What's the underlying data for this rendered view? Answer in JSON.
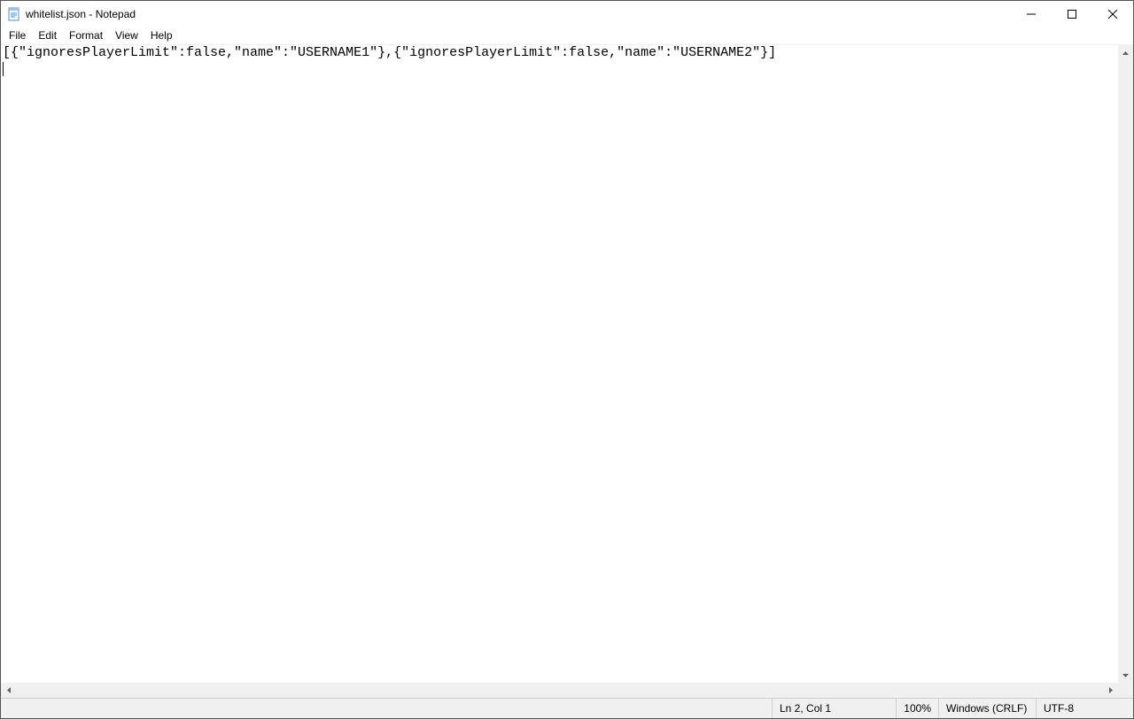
{
  "window": {
    "title": "whitelist.json - Notepad"
  },
  "menu": {
    "items": [
      "File",
      "Edit",
      "Format",
      "View",
      "Help"
    ]
  },
  "document": {
    "content": "[{\"ignoresPlayerLimit\":false,\"name\":\"USERNAME1\"},{\"ignoresPlayerLimit\":false,\"name\":\"USERNAME2\"}]"
  },
  "status": {
    "position": "Ln 2, Col 1",
    "zoom": "100%",
    "eol": "Windows (CRLF)",
    "encoding": "UTF-8"
  }
}
